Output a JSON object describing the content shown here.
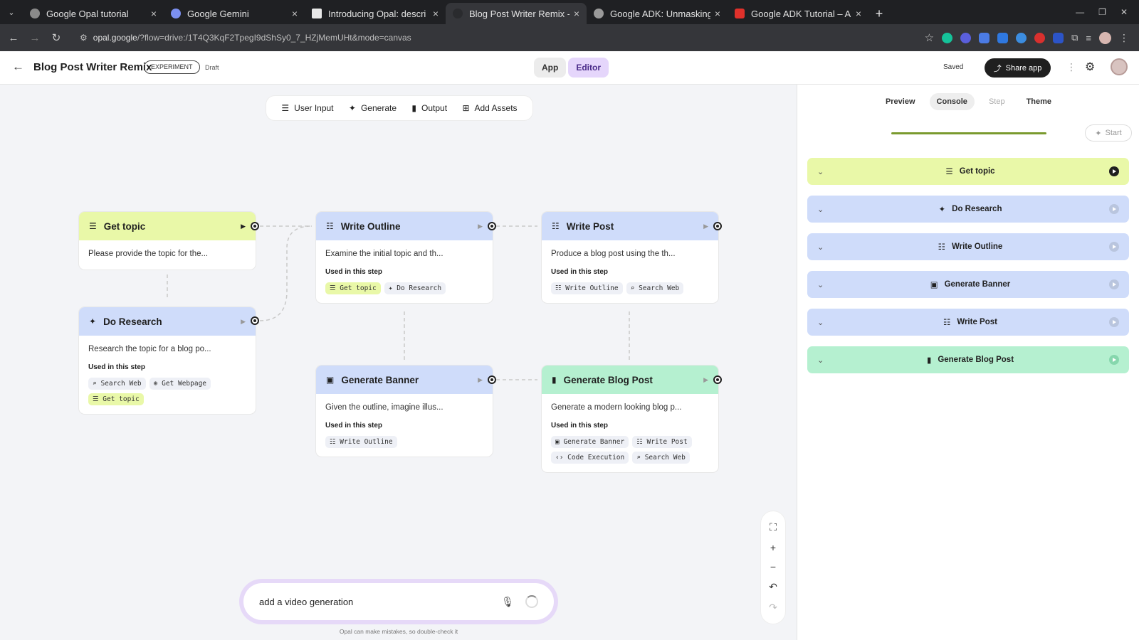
{
  "browser": {
    "tabs": [
      {
        "title": "Google Opal tutorial",
        "color": "#8a8a8a"
      },
      {
        "title": "Google Gemini",
        "color": "#7b8ff0"
      },
      {
        "title": "Introducing Opal: descri",
        "color": "#e8e8e8"
      },
      {
        "title": "Blog Post Writer Remix -",
        "color": "#35363a"
      },
      {
        "title": "Google ADK: Unmasking",
        "color": "#9a9a9a"
      },
      {
        "title": "Google ADK Tutorial – A",
        "color": "#e0312b"
      }
    ],
    "url_host": "opal.google",
    "url_path": "/?flow=drive:/1T4Q3KqF2TpegI9dShSy0_7_HZjMemUHt&mode=canvas"
  },
  "header": {
    "title": "Blog Post Writer Remix",
    "badge": "EXPERIMENT",
    "status": "Draft",
    "app_label": "App",
    "editor_label": "Editor",
    "saved": "Saved",
    "share": "Share app"
  },
  "palette": {
    "user_input": "User Input",
    "generate": "Generate",
    "output": "Output",
    "add_assets": "Add Assets"
  },
  "nodes": {
    "get_topic": {
      "title": "Get topic",
      "desc": "Please provide the topic for the..."
    },
    "do_research": {
      "title": "Do Research",
      "desc": "Research the topic for a blog po...",
      "used": "Used in this step",
      "chips": [
        "Search Web",
        "Get Webpage",
        "Get topic"
      ]
    },
    "write_outline": {
      "title": "Write Outline",
      "desc": "Examine the initial topic and th...",
      "used": "Used in this step",
      "chips": [
        "Get topic",
        "Do Research"
      ]
    },
    "write_post": {
      "title": "Write Post",
      "desc": "Produce a blog post using the th...",
      "used": "Used in this step",
      "chips": [
        "Write Outline",
        "Search Web"
      ]
    },
    "generate_banner": {
      "title": "Generate Banner",
      "desc": "Given the outline, imagine illus...",
      "used": "Used in this step",
      "chips": [
        "Write Outline"
      ]
    },
    "generate_blog_post": {
      "title": "Generate Blog Post",
      "desc": "Generate a modern looking blog p...",
      "used": "Used in this step",
      "chips": [
        "Generate Banner",
        "Write Post",
        "Code Execution",
        "Search Web"
      ]
    }
  },
  "prompt": {
    "text": "add a video generation",
    "disclaimer": "Opal can make mistakes, so double-check it"
  },
  "right_panel": {
    "tabs": [
      "Preview",
      "Console",
      "Step",
      "Theme"
    ],
    "start": "Start",
    "steps": [
      {
        "label": "Get topic"
      },
      {
        "label": "Do Research"
      },
      {
        "label": "Write Outline"
      },
      {
        "label": "Generate Banner"
      },
      {
        "label": "Write Post"
      },
      {
        "label": "Generate Blog Post"
      }
    ]
  },
  "colors": {
    "input_node": "#e9f8a8",
    "generate_node": "#cfdcfa",
    "output_node": "#b5f0d0",
    "editor_toggle": "#e5d6fb"
  }
}
